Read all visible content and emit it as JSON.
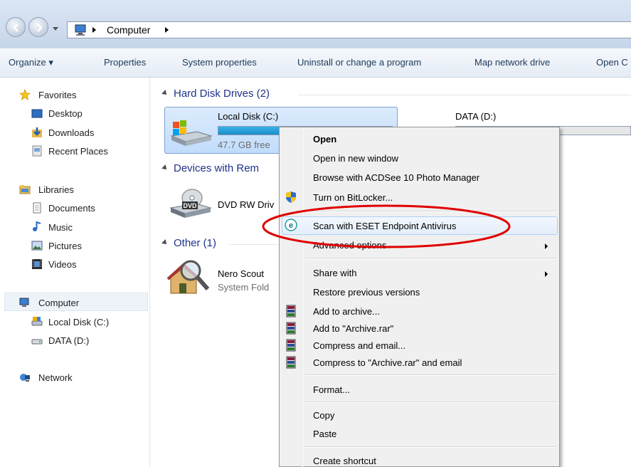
{
  "address_bar": {
    "path": [
      "Computer"
    ]
  },
  "command_bar": {
    "items": [
      "Organize ▾",
      "Properties",
      "System properties",
      "Uninstall or change a program",
      "Map network drive",
      "Open C"
    ]
  },
  "nav_pane": {
    "favorites": {
      "header": "Favorites",
      "items": [
        "Desktop",
        "Downloads",
        "Recent Places"
      ]
    },
    "libraries": {
      "header": "Libraries",
      "items": [
        "Documents",
        "Music",
        "Pictures",
        "Videos"
      ]
    },
    "computer": {
      "header": "Computer",
      "items": [
        "Local Disk (C:)",
        "DATA (D:)"
      ]
    },
    "network": {
      "header": "Network"
    }
  },
  "content": {
    "hard_disks": {
      "header": "Hard Disk Drives (2)",
      "drive_c": {
        "name": "Local Disk (C:)",
        "free": "47.7 GB free",
        "usage_fraction": 0.82
      },
      "drive_d": {
        "name": "DATA (D:)"
      }
    },
    "removable": {
      "header": "Devices with Rem",
      "dvd": {
        "name": "DVD RW Driv",
        "badge": "DVD"
      }
    },
    "other": {
      "header": "Other (1)",
      "nero": {
        "name": "Nero Scout",
        "sub": "System Fold"
      }
    }
  },
  "context_menu": {
    "items": [
      {
        "label": "Open",
        "bold": true
      },
      {
        "label": "Open in new window"
      },
      {
        "label": "Browse with ACDSee 10 Photo Manager"
      },
      {
        "label": "Turn on BitLocker...",
        "icon": "shield-icon"
      },
      {
        "label": "Scan with ESET Endpoint Antivirus",
        "icon": "eset-icon",
        "highlighted": true
      },
      {
        "label": "Advanced options",
        "submenu": true
      },
      {
        "label": "Share with",
        "submenu": true
      },
      {
        "label": "Restore previous versions"
      },
      {
        "label": "Add to archive...",
        "icon": "winrar-icon"
      },
      {
        "label": "Add to \"Archive.rar\"",
        "icon": "winrar-icon"
      },
      {
        "label": "Compress and email...",
        "icon": "winrar-icon"
      },
      {
        "label": "Compress to \"Archive.rar\" and email",
        "icon": "winrar-icon"
      },
      {
        "label": "Format..."
      },
      {
        "label": "Copy"
      },
      {
        "label": "Paste"
      },
      {
        "label": "Create shortcut"
      }
    ]
  },
  "colors": {
    "accent_blue": "#1e3287",
    "annotation_red": "#e00000",
    "progress_fill": "#26a0da"
  }
}
